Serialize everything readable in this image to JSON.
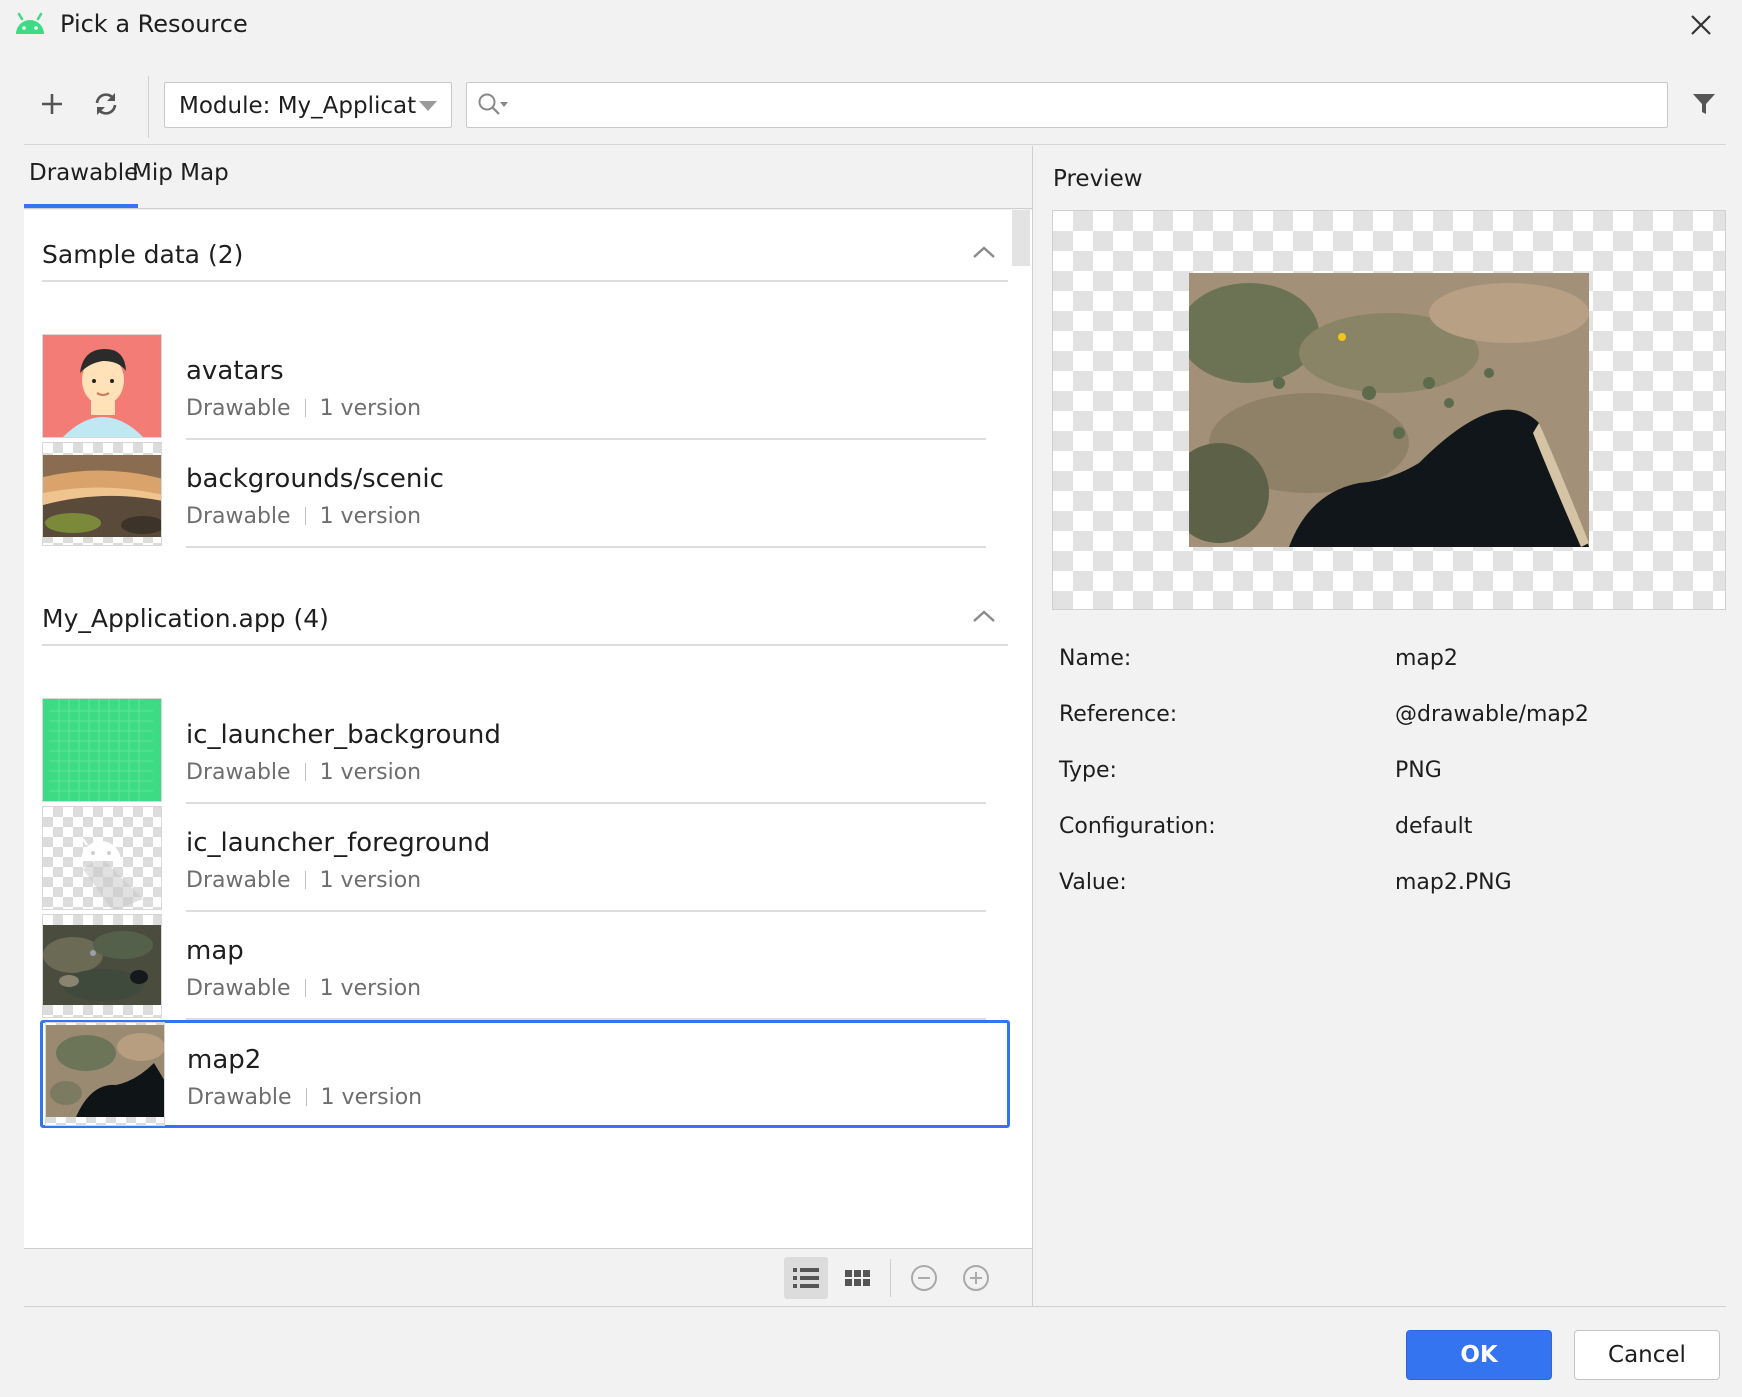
{
  "window": {
    "title": "Pick a Resource",
    "icon": "android-icon",
    "close_icon": "close-icon"
  },
  "toolbar": {
    "add_icon": "plus-icon",
    "refresh_icon": "refresh-icon",
    "module_label": "Module: My_Applicat",
    "search_placeholder": "",
    "search_value": "",
    "filter_icon": "filter-icon"
  },
  "tabs": [
    {
      "label": "Drawable",
      "active": true
    },
    {
      "label": "Mip Map",
      "active": false
    }
  ],
  "sections": [
    {
      "title": "Sample data (2)",
      "items": [
        {
          "name": "avatars",
          "type": "Drawable",
          "versions": "1 version"
        },
        {
          "name": "backgrounds/scenic",
          "type": "Drawable",
          "versions": "1 version"
        }
      ]
    },
    {
      "title": "My_Application.app (4)",
      "items": [
        {
          "name": "ic_launcher_background",
          "type": "Drawable",
          "versions": "1 version"
        },
        {
          "name": "ic_launcher_foreground",
          "type": "Drawable",
          "versions": "1 version"
        },
        {
          "name": "map",
          "type": "Drawable",
          "versions": "1 version"
        },
        {
          "name": "map2",
          "type": "Drawable",
          "versions": "1 version",
          "selected": true
        }
      ]
    }
  ],
  "view_controls": {
    "list_view_icon": "list-view-icon",
    "grid_view_icon": "grid-view-icon",
    "zoom_out_icon": "zoom-out-icon",
    "zoom_in_icon": "zoom-in-icon",
    "active_view": "list"
  },
  "preview": {
    "label": "Preview",
    "properties": [
      {
        "label": "Name:",
        "value": "map2"
      },
      {
        "label": "Reference:",
        "value": "@drawable/map2"
      },
      {
        "label": "Type:",
        "value": "PNG"
      },
      {
        "label": "Configuration:",
        "value": "default"
      },
      {
        "label": "Value:",
        "value": "map2.PNG"
      }
    ]
  },
  "buttons": {
    "ok": "OK",
    "cancel": "Cancel"
  },
  "colors": {
    "accent": "#3574f0",
    "avatar_bg": "#f47c76",
    "launcher_bg": "#3ddc84"
  }
}
